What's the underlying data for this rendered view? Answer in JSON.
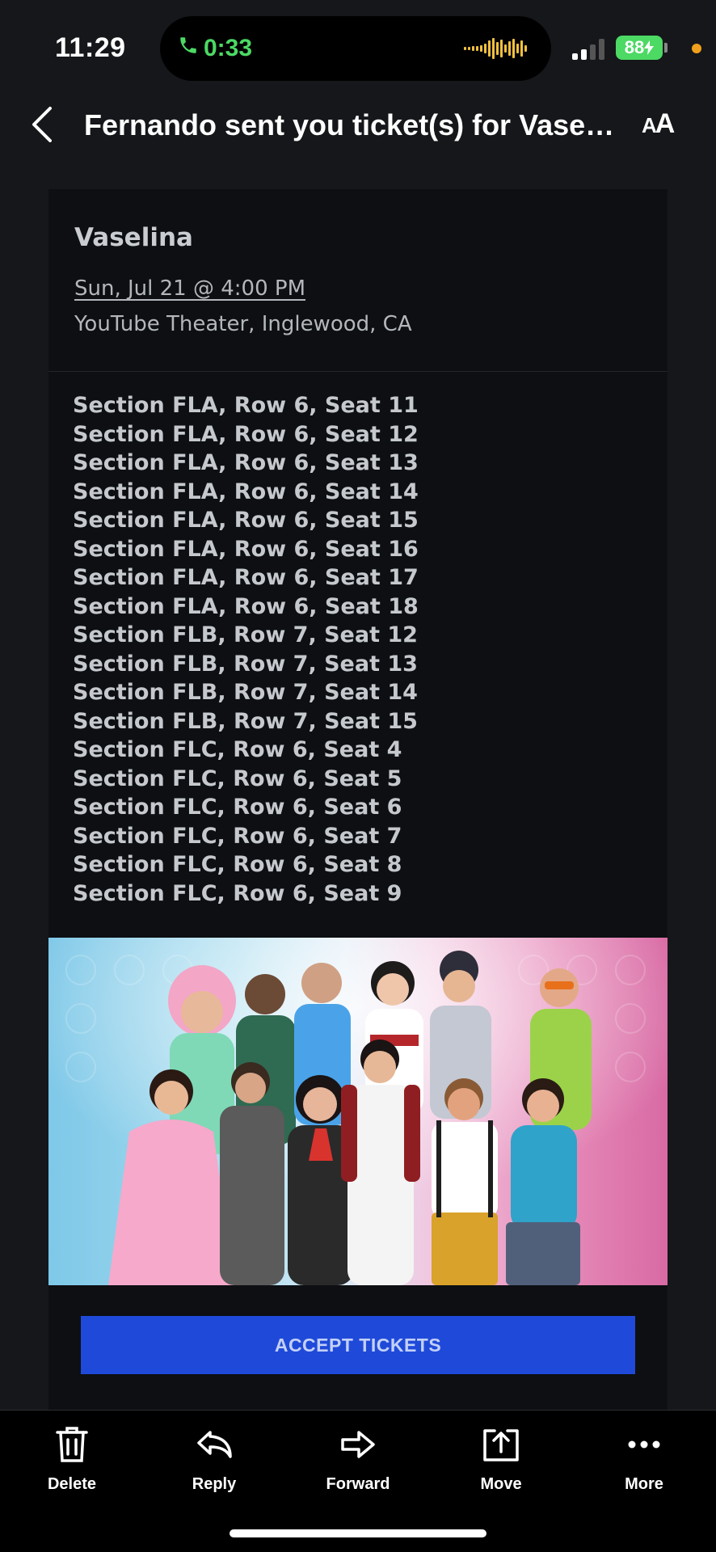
{
  "status_bar": {
    "time": "11:29",
    "call_duration": "0:33",
    "battery": "88",
    "call_color": "#4cd964",
    "battery_color": "#4cd964",
    "indicator_color": "#f0a01c"
  },
  "nav": {
    "title": "Fernando sent you ticket(s) for Vasel...",
    "back_icon": "chevron-left-icon",
    "font_size_label_large": "A",
    "font_size_label_small": "A"
  },
  "email": {
    "event_title": "Vaselina",
    "event_date": "Sun, Jul 21 @ 4:00 PM",
    "event_venue": "YouTube Theater, Inglewood, CA",
    "seats": [
      "Section FLA, Row 6, Seat 11",
      "Section FLA, Row 6, Seat 12",
      "Section FLA, Row 6, Seat 13",
      "Section FLA, Row 6, Seat 14",
      "Section FLA, Row 6, Seat 15",
      "Section FLA, Row 6, Seat 16",
      "Section FLA, Row 6, Seat 17",
      "Section FLA, Row 6, Seat 18",
      "Section FLB, Row 7, Seat 12",
      "Section FLB, Row 7, Seat 13",
      "Section FLB, Row 7, Seat 14",
      "Section FLB, Row 7, Seat 15",
      "Section FLC, Row 6, Seat 4",
      "Section FLC, Row 6, Seat 5",
      "Section FLC, Row 6, Seat 6",
      "Section FLC, Row 6, Seat 7",
      "Section FLC, Row 6, Seat 8",
      "Section FLC, Row 6, Seat 9"
    ],
    "accept_label": "ACCEPT TICKETS",
    "accept_color": "#1f4ad9"
  },
  "toolbar": {
    "delete": "Delete",
    "reply": "Reply",
    "forward": "Forward",
    "move": "Move",
    "more": "More"
  }
}
